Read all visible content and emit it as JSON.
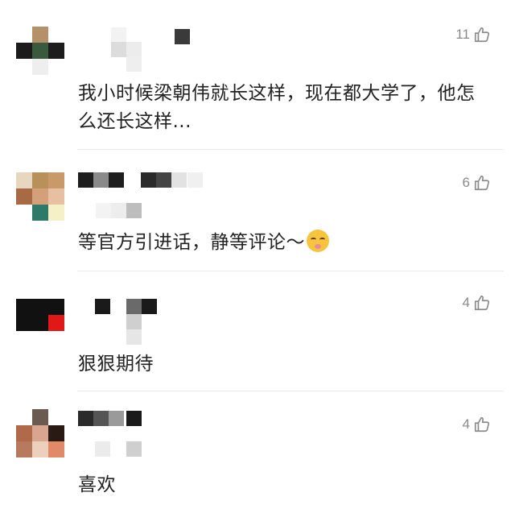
{
  "comments": [
    {
      "likes": "11",
      "text": "我小时候梁朝伟就长这样，现在都大学了，他怎么还长这样...",
      "avatar_colors": [
        "#ffffff",
        "#b5916a",
        "#ffffff",
        "#1b1b1b",
        "#3a5a3e",
        "#1d1d1d",
        "#ffffff",
        "#eeeeee",
        "#ffffff"
      ]
    },
    {
      "likes": "6",
      "text": "等官方引进话，静等评论～",
      "emoji": "flushed-face-emoji",
      "avatar_colors": [
        "#e8d7c0",
        "#b8905a",
        "#c89a6a",
        "#a86a45",
        "#d4a07a",
        "#e6c0a0",
        "#ffffff",
        "#2e7a6a",
        "#f5f0c5"
      ]
    },
    {
      "likes": "4",
      "text": "狠狠期待",
      "avatar_colors": [
        "#111111",
        "#111111",
        "#111111",
        "#111111",
        "#111111",
        "#e01818",
        "#ffffff",
        "#ffffff",
        "#ffffff"
      ]
    },
    {
      "likes": "4",
      "text": "喜欢",
      "avatar_colors": [
        "#ffffff",
        "#6b5a50",
        "#ffffff",
        "#b06a4a",
        "#d8a68e",
        "#2a1a14",
        "#b77a5e",
        "#ecd0bb",
        "#e08a6a"
      ]
    }
  ],
  "icons": {
    "like": "thumbs-up-icon"
  },
  "colors": {
    "text": "#222222",
    "meta": "#8a8a8a",
    "divider": "#ececec"
  }
}
